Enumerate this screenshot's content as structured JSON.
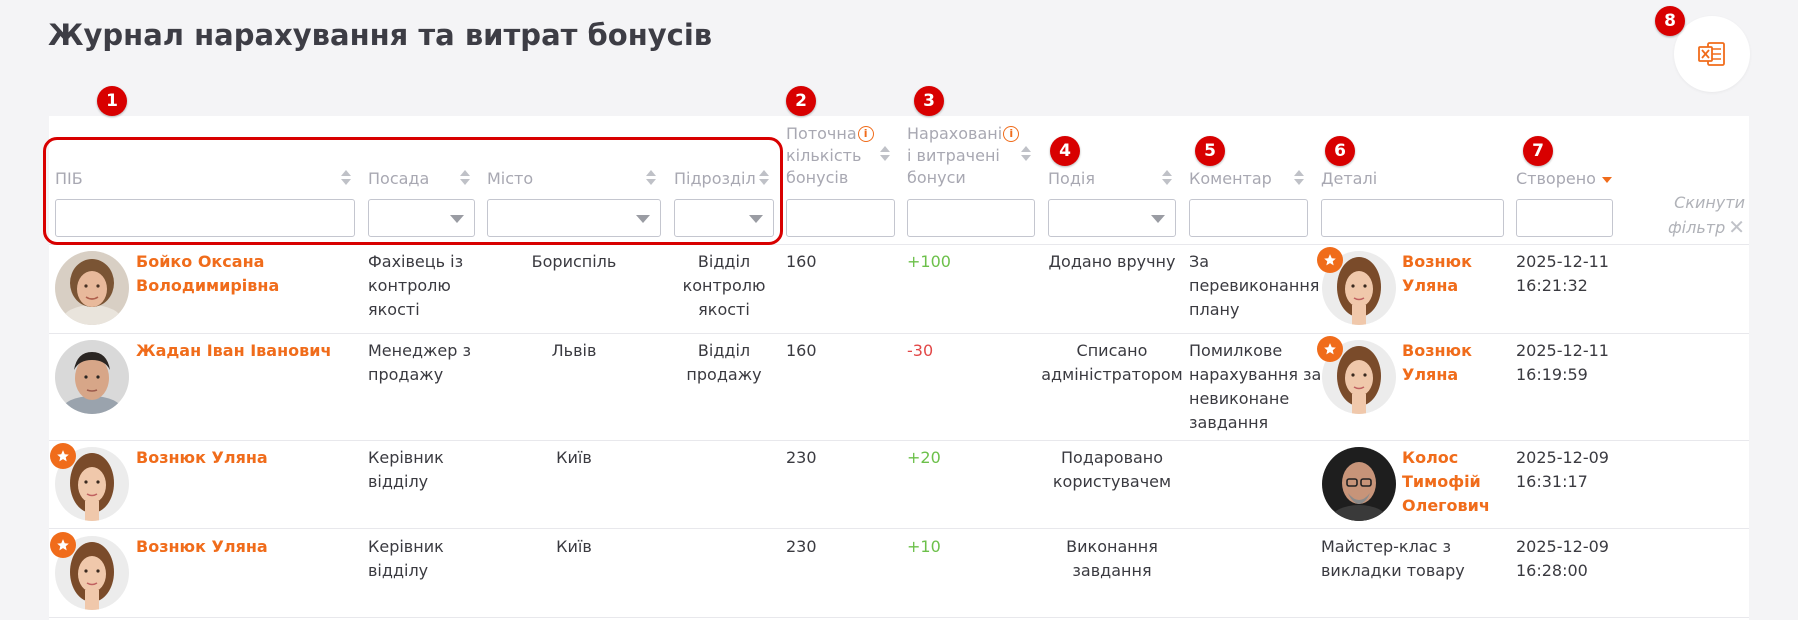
{
  "page": {
    "title": "Журнал нарахування та витрат бонусів",
    "export_icon": "excel-export-icon"
  },
  "badges": [
    "1",
    "2",
    "3",
    "4",
    "5",
    "6",
    "7",
    "8"
  ],
  "columns": {
    "pib": "ПІБ",
    "posada": "Посада",
    "misto": "Місто",
    "pidrozdil": "Підрозділ",
    "current_1": "Поточна",
    "current_2": "кількість",
    "current_3": "бонусів",
    "accrued_1": "Нараховані",
    "accrued_2": "і витрачені",
    "accrued_3": "бонуси",
    "event": "Подія",
    "comment": "Коментар",
    "details": "Деталі",
    "created": "Створено"
  },
  "filters": {
    "reset_label_1": "Скинути",
    "reset_label_2": "фільтр"
  },
  "colors": {
    "accent": "#f06c1b",
    "badge": "#d80000",
    "positive": "#6cc04a",
    "negative": "#e24848"
  },
  "rows": [
    {
      "name_1": "Бойко Оксана",
      "name_2": "Володимирівна",
      "position_1": "Фахівець із",
      "position_2": "контролю",
      "position_3": "якості",
      "city": "Бориспіль",
      "dept_1": "Відділ",
      "dept_2": "контролю",
      "dept_3": "якості",
      "current": "160",
      "delta": "+100",
      "event_1": "Додано вручну",
      "event_2": "",
      "comment_1": "За",
      "comment_2": "перевиконання",
      "comment_3": "плану",
      "comment_4": "",
      "details_1": "Вознюк",
      "details_2": "Уляна",
      "details_3": "",
      "date": "2025-12-11",
      "time": "16:21:32"
    },
    {
      "name_1": "Жадан Іван Іванович",
      "name_2": "",
      "position_1": "Менеджер з",
      "position_2": "продажу",
      "position_3": "",
      "city": "Львів",
      "dept_1": "Відділ",
      "dept_2": "продажу",
      "dept_3": "",
      "current": "160",
      "delta": "-30",
      "event_1": "Списано",
      "event_2": "адміністратором",
      "comment_1": "Помилкове",
      "comment_2": "нарахування за",
      "comment_3": "невиконане",
      "comment_4": "завдання",
      "details_1": "Вознюк",
      "details_2": "Уляна",
      "details_3": "",
      "date": "2025-12-11",
      "time": "16:19:59"
    },
    {
      "name_1": "Вознюк Уляна",
      "name_2": "",
      "position_1": "Керівник",
      "position_2": "відділу",
      "position_3": "",
      "city": "Київ",
      "dept_1": "",
      "dept_2": "",
      "dept_3": "",
      "current": "230",
      "delta": "+20",
      "event_1": "Подаровано",
      "event_2": "користувачем",
      "comment_1": "",
      "comment_2": "",
      "comment_3": "",
      "comment_4": "",
      "details_1": "Колос",
      "details_2": "Тимофій",
      "details_3": "Олегович",
      "date": "2025-12-09",
      "time": "16:31:17"
    },
    {
      "name_1": "Вознюк Уляна",
      "name_2": "",
      "position_1": "Керівник",
      "position_2": "відділу",
      "position_3": "",
      "city": "Київ",
      "dept_1": "",
      "dept_2": "",
      "dept_3": "",
      "current": "230",
      "delta": "+10",
      "event_1": "Виконання",
      "event_2": "завдання",
      "comment_1": "",
      "comment_2": "",
      "comment_3": "",
      "comment_4": "",
      "details_1": "Майстер-клас з",
      "details_2": "викладки товару",
      "details_3": "",
      "date": "2025-12-09",
      "time": "16:28:00"
    }
  ]
}
